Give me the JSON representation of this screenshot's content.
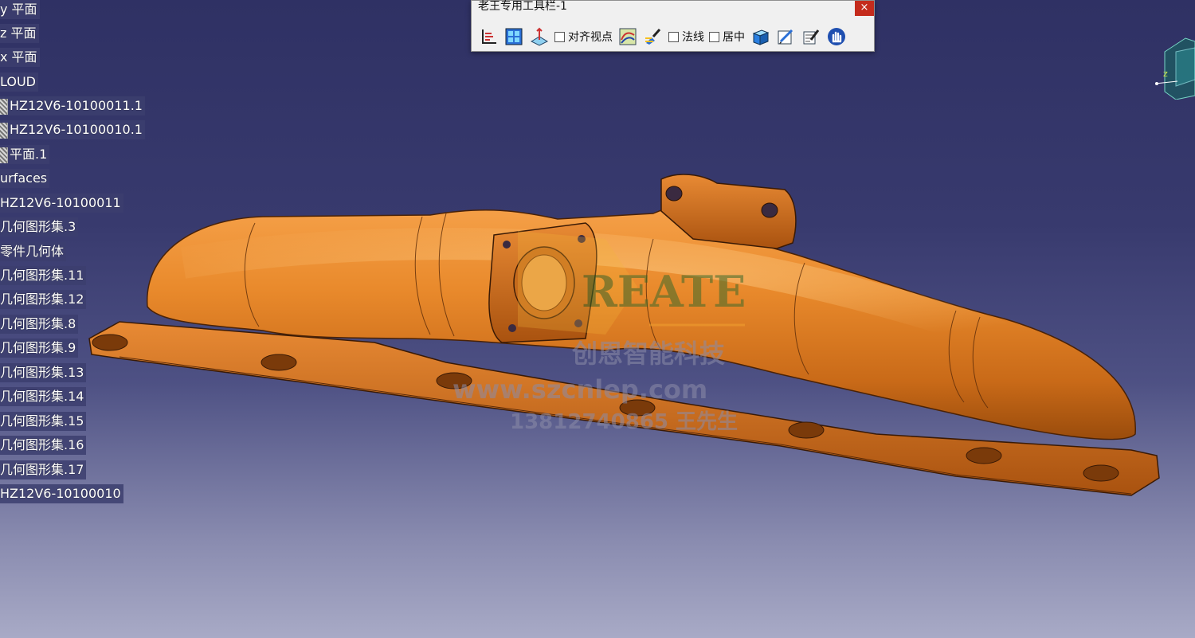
{
  "toolbar": {
    "title": "老王专用工具栏-1",
    "close_label": "×",
    "checkboxes": {
      "align_viewpoint": "对齐视点",
      "normal": "法线",
      "center": "居中"
    }
  },
  "tree": {
    "items": [
      {
        "label": "y 平面",
        "icon": false
      },
      {
        "label": "z 平面",
        "icon": false
      },
      {
        "label": "x 平面",
        "icon": false
      },
      {
        "label": "LOUD",
        "icon": false
      },
      {
        "label": "HZ12V6-10100011.1",
        "icon": true
      },
      {
        "label": "HZ12V6-10100010.1",
        "icon": true
      },
      {
        "label": "平面.1",
        "icon": true
      },
      {
        "label": "urfaces",
        "icon": false
      },
      {
        "label": "HZ12V6-10100011",
        "icon": false
      },
      {
        "label": "几何图形集.3",
        "icon": false
      },
      {
        "label": "零件几何体",
        "icon": false
      },
      {
        "label": "几何图形集.11",
        "icon": false
      },
      {
        "label": "几何图形集.12",
        "icon": false
      },
      {
        "label": "几何图形集.8",
        "icon": false
      },
      {
        "label": "几何图形集.9",
        "icon": false
      },
      {
        "label": "几何图形集.13",
        "icon": false
      },
      {
        "label": "几何图形集.14",
        "icon": false
      },
      {
        "label": "几何图形集.15",
        "icon": false
      },
      {
        "label": "几何图形集.16",
        "icon": false
      },
      {
        "label": "几何图形集.17",
        "icon": false
      },
      {
        "label": "HZ12V6-10100010",
        "icon": false
      }
    ]
  },
  "watermark": {
    "brand": "REATE",
    "company": "创恩智能科技",
    "url": "www.szcnlep.com",
    "phone": "13812740865 王先生"
  },
  "compass": {
    "axis_label": "z"
  },
  "colors": {
    "part": "#e8822a",
    "background_top": "#2f3164",
    "background_bottom": "#a8aac6",
    "close": "#c42b1c"
  }
}
